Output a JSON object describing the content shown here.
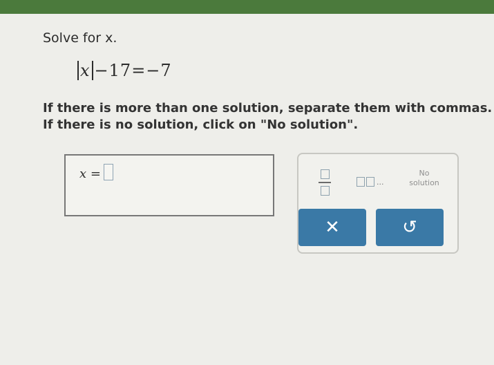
{
  "question": {
    "prompt": "Solve for x.",
    "equation": {
      "variable": "x",
      "rest": "−17=−7"
    },
    "instruction_1": "If there is more than one solution, separate them with commas.",
    "instruction_2": "If there is no solution, click on \"No solution\"."
  },
  "answer": {
    "label": "x =",
    "value": ""
  },
  "keypad": {
    "fraction_icon": "fraction-icon",
    "list_icon": "list-icon",
    "list_dots": "...",
    "no_solution_line1": "No",
    "no_solution_line2": "solution",
    "clear_icon": "✕",
    "undo_icon": "↺"
  },
  "colors": {
    "top_bar": "#4b7a3c",
    "button": "#3a79a6"
  }
}
